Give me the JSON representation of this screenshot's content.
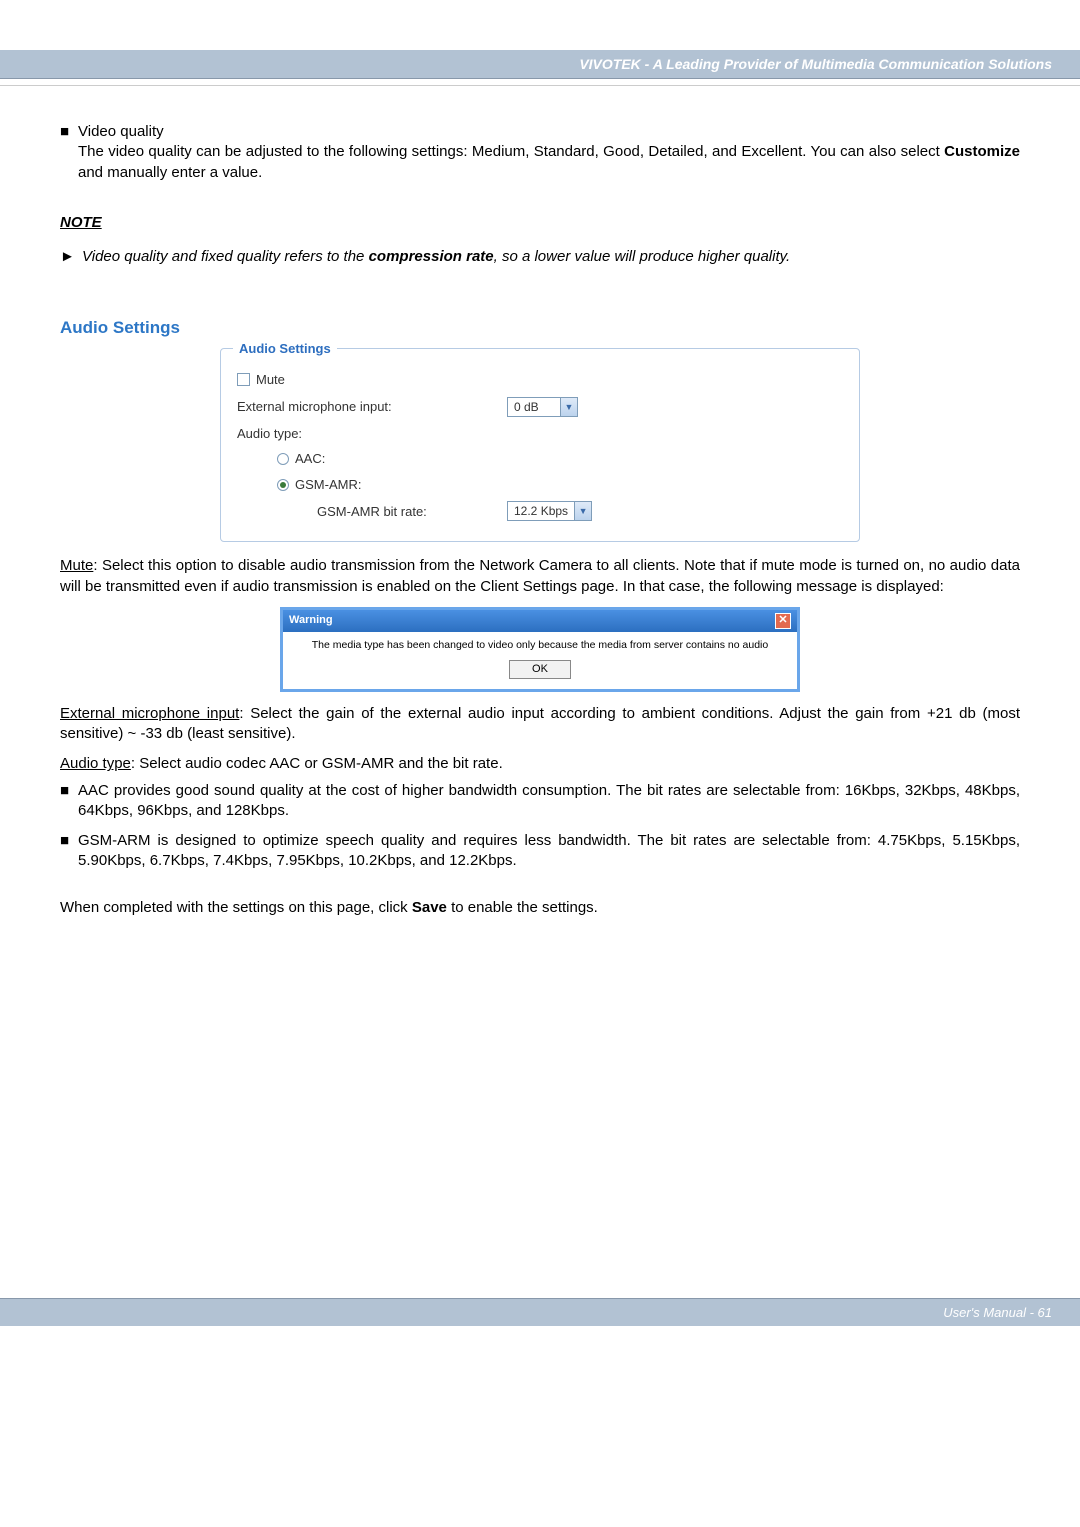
{
  "header": {
    "title": "VIVOTEK - A Leading Provider of Multimedia Communication Solutions"
  },
  "video_quality": {
    "heading": "Video quality",
    "desc_prefix": "The video quality can be adjusted to the following settings: Medium, Standard, Good, Detailed, and Excellent. You can also select ",
    "customize": "Customize",
    "desc_suffix": " and manually enter a value."
  },
  "note": {
    "heading": "NOTE",
    "prefix": "Video quality and fixed quality refers to the ",
    "bold": "compression rate",
    "suffix": ", so a lower value will produce higher quality."
  },
  "audio": {
    "section_heading": "Audio Settings",
    "legend": "Audio Settings",
    "mute_label": "Mute",
    "ext_mic_label": "External microphone input:",
    "ext_mic_value": "0 dB",
    "audio_type_label": "Audio type:",
    "aac_label": "AAC:",
    "gsm_label": "GSM-AMR:",
    "bitrate_label": "GSM-AMR bit rate:",
    "bitrate_value": "12.2 Kbps"
  },
  "dialog": {
    "title": "Warning",
    "message": "The media type has been changed to video only because the media from server contains no audio",
    "ok": "OK"
  },
  "paras": {
    "mute_head": "Mute",
    "mute_rest": ": Select this option to disable audio transmission from the Network Camera to all clients. Note that if mute mode is turned on, no audio data will be transmitted even if audio transmission is enabled on the Client Settings page. In that case, the following message is displayed:",
    "ext_head": "External microphone input",
    "ext_rest": ": Select the gain of the external audio input according to ambient conditions. Adjust the gain from +21 db (most sensitive) ~ -33 db (least sensitive).",
    "atype_head": "Audio type",
    "atype_rest": ": Select audio codec AAC or GSM-AMR and the bit rate.",
    "aac_bullet": "AAC provides good sound quality at the cost of higher bandwidth consumption. The bit rates are selectable from: 16Kbps, 32Kbps, 48Kbps, 64Kbps, 96Kbps, and 128Kbps.",
    "gsm_bullet": "GSM-ARM is designed to optimize speech quality and requires less bandwidth. The bit rates are selectable from: 4.75Kbps, 5.15Kbps, 5.90Kbps, 6.7Kbps, 7.4Kbps, 7.95Kbps, 10.2Kbps, and 12.2Kbps.",
    "save_prefix": "When completed with the settings on this page, click ",
    "save_bold": "Save",
    "save_suffix": " to enable the settings."
  },
  "footer": {
    "text": "User's Manual - 61"
  }
}
